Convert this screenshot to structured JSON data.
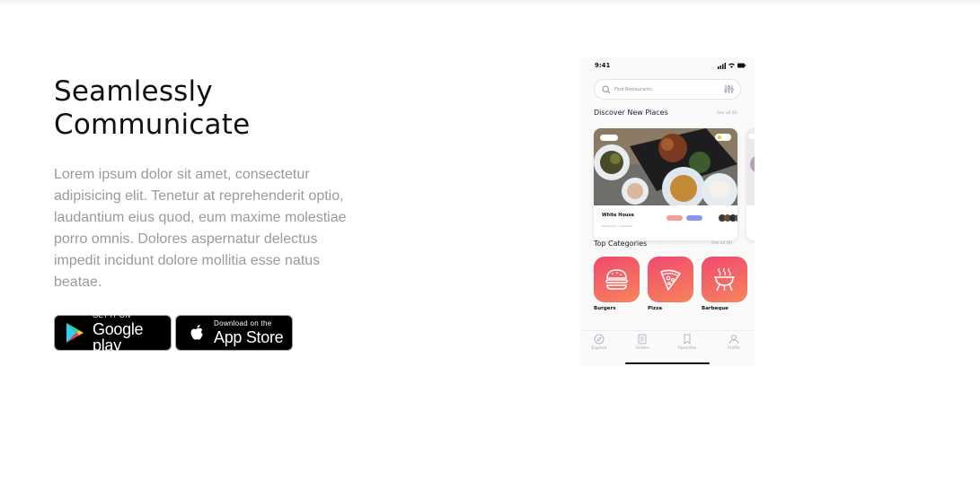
{
  "hero": {
    "title_line1": "Seamlessly",
    "title_line2": "Communicate",
    "body": "Lorem ipsum dolor sit amet, consectetur adipisicing elit. Tenetur at reprehenderit optio, laudantium eius quod, eum maxime molestiae porro omnis. Dolores aspernatur delectus impedit incidunt dolore mollitia esse natus beatae."
  },
  "badges": {
    "google": {
      "small": "GET IT ON",
      "big": "Google play",
      "icon": "google-play-icon"
    },
    "apple": {
      "small": "Download on the",
      "big": "App Store",
      "icon": "apple-icon"
    }
  },
  "phone": {
    "time": "9:41",
    "search_placeholder": "Find Restaurants",
    "discover_title": "Discover New Places",
    "discover_see_all": "See all (8)",
    "card": {
      "name": "White House",
      "sub": "Restaurant · Lebanese"
    },
    "categories_title": "Top Categories",
    "categories_see_all": "See all (9)",
    "categories": [
      {
        "label": "Burgers",
        "icon": "burger-icon"
      },
      {
        "label": "Pizza",
        "icon": "pizza-icon"
      },
      {
        "label": "Barbeque",
        "icon": "grill-icon"
      }
    ],
    "tabs": [
      {
        "label": "Explore",
        "icon": "compass-icon"
      },
      {
        "label": "Orders",
        "icon": "orders-icon"
      },
      {
        "label": "Favorites",
        "icon": "bookmark-icon"
      },
      {
        "label": "Profile",
        "icon": "profile-icon"
      }
    ]
  },
  "colors": {
    "category_gradient_start": "#f0496d",
    "category_gradient_end": "#f6845c",
    "title_text": "#111111",
    "body_text": "#9a9a9a"
  }
}
